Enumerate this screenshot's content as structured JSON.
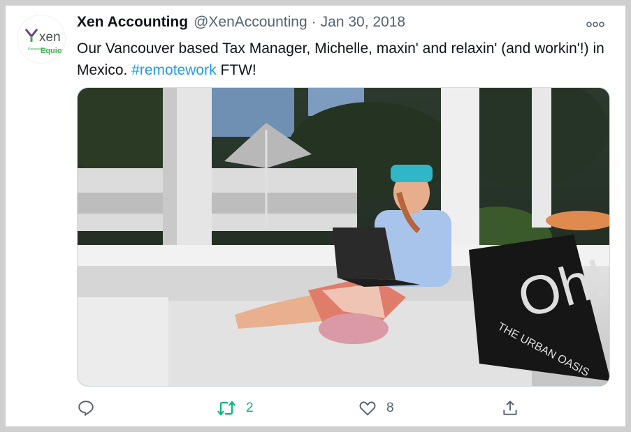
{
  "tweet": {
    "author_name": "Xen Accounting",
    "handle": "@XenAccounting",
    "separator": "·",
    "date": "Jan 30, 2018",
    "text_before": "Our Vancouver based Tax Manager, Michelle, maxin' and relaxin' (and workin'!) in Mexico.",
    "hashtag": "#remotework",
    "text_after": "FTW!"
  },
  "avatar": {
    "logo_text": "xen",
    "tagline": "Powered by",
    "brand": "Equiom"
  },
  "media": {
    "pillow_text_main": "Oh!",
    "pillow_text_sub": "THE URBAN OASIS"
  },
  "actions": {
    "reply_count": "",
    "retweet_count": "2",
    "like_count": "8"
  },
  "colors": {
    "hashtag": "#1d9bf0",
    "retweet": "#00ba7c",
    "muted": "#536471",
    "text": "#0f1419",
    "logo_purple": "#6a3d8f",
    "logo_green": "#3fae49"
  },
  "icons": [
    "more-icon",
    "reply-icon",
    "retweet-icon",
    "like-icon",
    "share-icon"
  ]
}
